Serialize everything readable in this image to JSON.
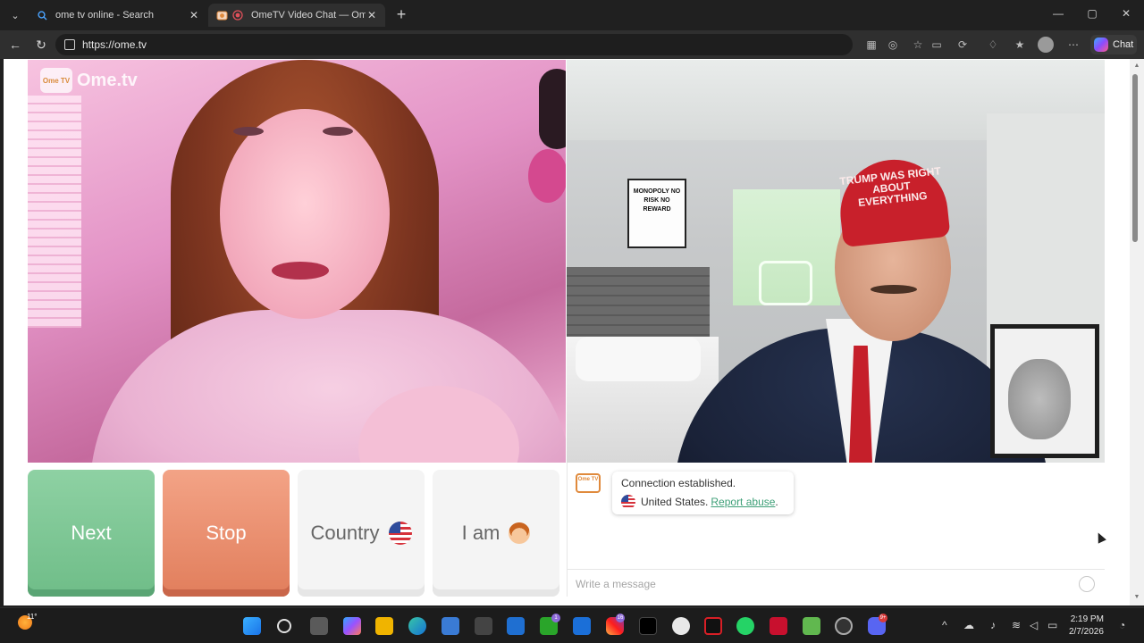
{
  "browser": {
    "tabs": [
      {
        "title": "ome tv online - Search",
        "close": "✕",
        "favicon": "search-icon"
      },
      {
        "title": "OmeTV Video Chat — Omegl",
        "close": "✕",
        "favicon": "ometv-icon"
      }
    ],
    "new_tab": "+",
    "window_controls": {
      "minimize": "—",
      "maximize": "▢",
      "close": "✕"
    },
    "url": "https://ome.tv",
    "chat_button": "Chat"
  },
  "site": {
    "logo_badge": "Ome TV",
    "logo_text": "Ome.tv",
    "controls": {
      "next": "Next",
      "stop": "Stop",
      "country": "Country",
      "country_flag": "us-flag-icon",
      "i_am": "I am",
      "i_am_icon": "boy-emoji-icon"
    },
    "chat": {
      "status": "Connection established.",
      "country": "United States.",
      "report": "Report abuse",
      "report_suffix": ".",
      "message_placeholder": "Write a message"
    },
    "scene_text": {
      "poster": "MONOPOLY NO RISK NO REWARD",
      "cap": "TRUMP WAS RIGHT ABOUT EVERYTHING"
    }
  },
  "taskbar": {
    "weather_temp": "11°",
    "clock_time": "2:19 PM",
    "clock_date": "2/7/2026",
    "badges": {
      "xbox": "1",
      "instagram": "16",
      "discord": "9+"
    }
  },
  "colors": {
    "next": "#7cc896",
    "stop": "#e98c6c",
    "report_link": "#3d9f77",
    "logo_orange": "#e08a3c"
  }
}
